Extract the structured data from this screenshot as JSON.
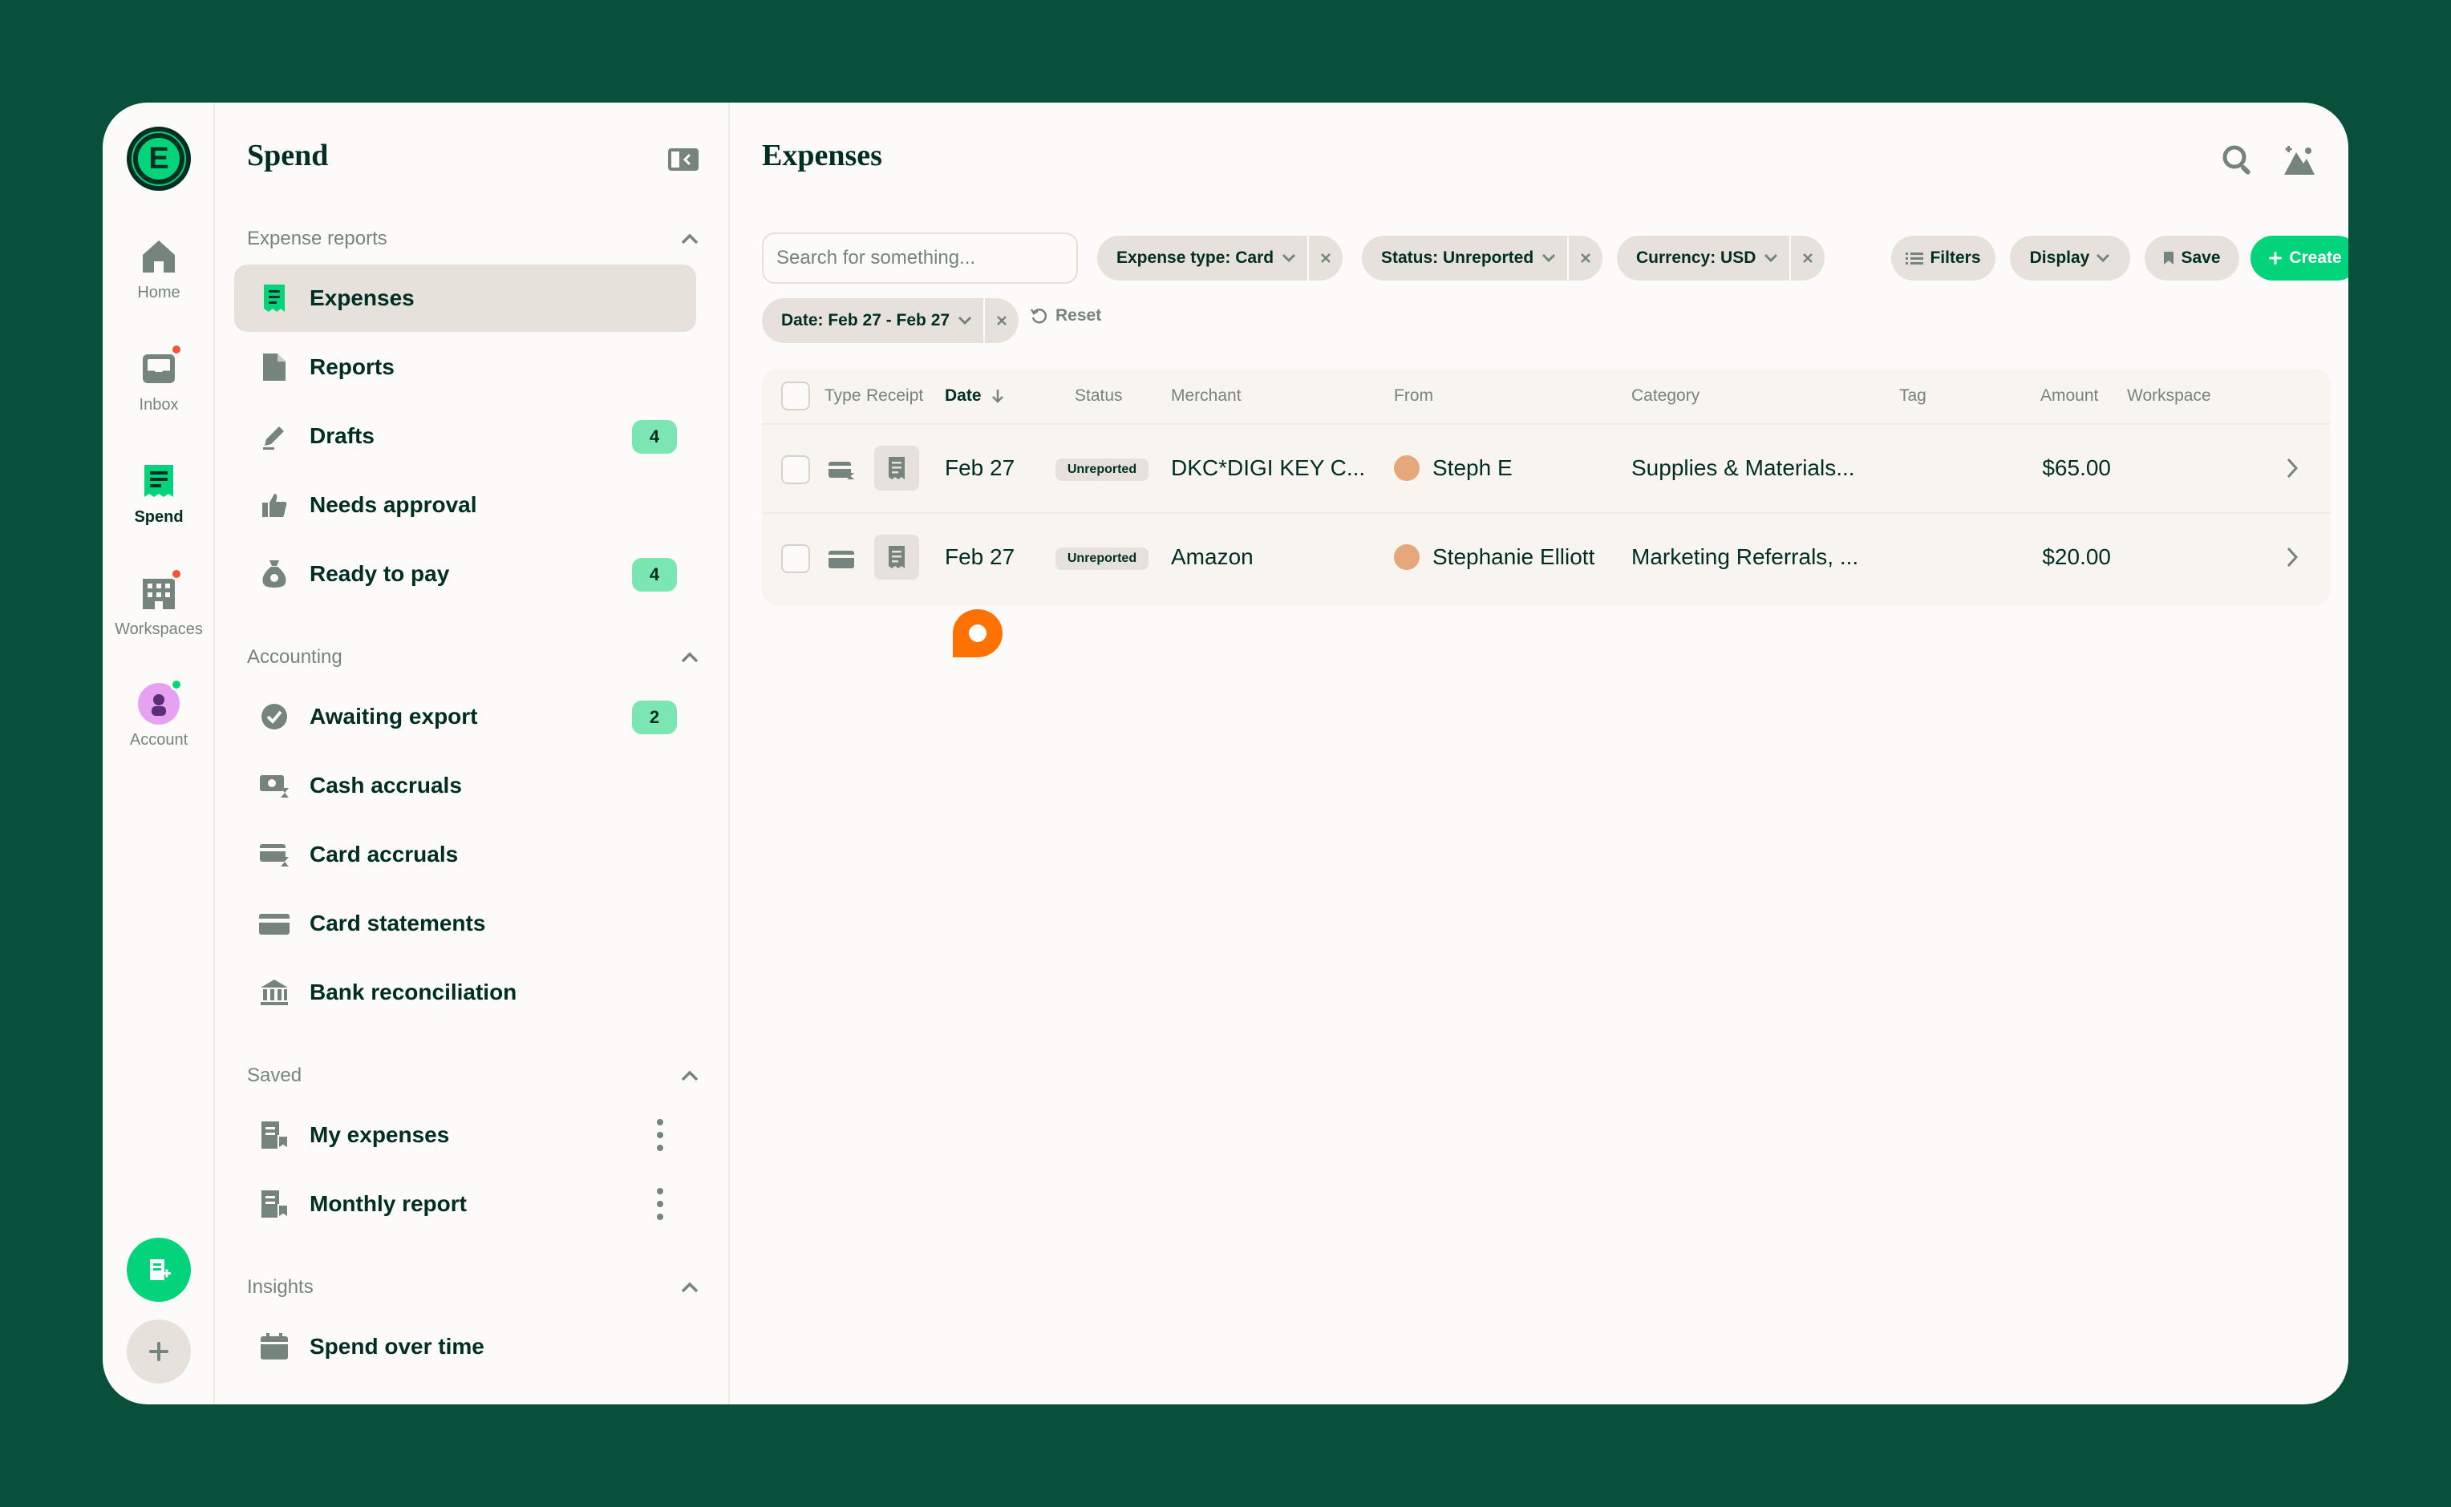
{
  "colors": {
    "background": "#08503A",
    "accent": "#03D47C",
    "text": "#002E22",
    "muted": "#76847E",
    "badge": "#7CE6B3",
    "notification": "#F25730"
  },
  "rail": {
    "items": [
      {
        "label": "Home",
        "icon": "home-icon"
      },
      {
        "label": "Inbox",
        "icon": "inbox-icon"
      },
      {
        "label": "Spend",
        "icon": "spend-icon"
      },
      {
        "label": "Workspaces",
        "icon": "building-icon"
      },
      {
        "label": "Account",
        "icon": "avatar"
      }
    ]
  },
  "sidebar": {
    "title": "Spend",
    "sections": [
      {
        "title": "Expense reports"
      },
      {
        "title": "Accounting"
      },
      {
        "title": "Saved"
      },
      {
        "title": "Insights"
      }
    ],
    "items": [
      {
        "label": "Expenses"
      },
      {
        "label": "Reports"
      },
      {
        "label": "Drafts",
        "badge": "4"
      },
      {
        "label": "Needs approval"
      },
      {
        "label": "Ready to pay",
        "badge": "4"
      },
      {
        "label": "Awaiting export",
        "badge": "2"
      },
      {
        "label": "Cash accruals"
      },
      {
        "label": "Card accruals"
      },
      {
        "label": "Card statements"
      },
      {
        "label": "Bank reconciliation"
      },
      {
        "label": "My expenses"
      },
      {
        "label": "Monthly report"
      },
      {
        "label": "Spend over time"
      }
    ]
  },
  "main": {
    "title": "Expenses",
    "search": {
      "placeholder": "Search for something...",
      "value": ""
    },
    "filters": [
      {
        "label": "Expense type: Card"
      },
      {
        "label": "Status: Unreported"
      },
      {
        "label": "Currency: USD"
      },
      {
        "label": "Date: Feb 27 - Feb 27"
      }
    ],
    "reset_label": "Reset",
    "buttons": {
      "filters": "Filters",
      "display": "Display",
      "save": "Save",
      "create": "Create"
    },
    "table": {
      "columns": [
        "Type",
        "Receipt",
        "Date",
        "Status",
        "Merchant",
        "From",
        "Category",
        "Tag",
        "Amount",
        "Workspace"
      ],
      "rows": [
        {
          "date": "Feb 27",
          "status": "Unreported",
          "merchant": "DKC*DIGI KEY C...",
          "from": "Steph E",
          "category": "Supplies & Materials...",
          "tag": "",
          "amount": "$65.00",
          "workspace": ""
        },
        {
          "date": "Feb 27",
          "status": "Unreported",
          "merchant": "Amazon",
          "from": "Stephanie Elliott",
          "category": "Marketing Referrals, ...",
          "tag": "",
          "amount": "$20.00",
          "workspace": ""
        }
      ]
    }
  }
}
